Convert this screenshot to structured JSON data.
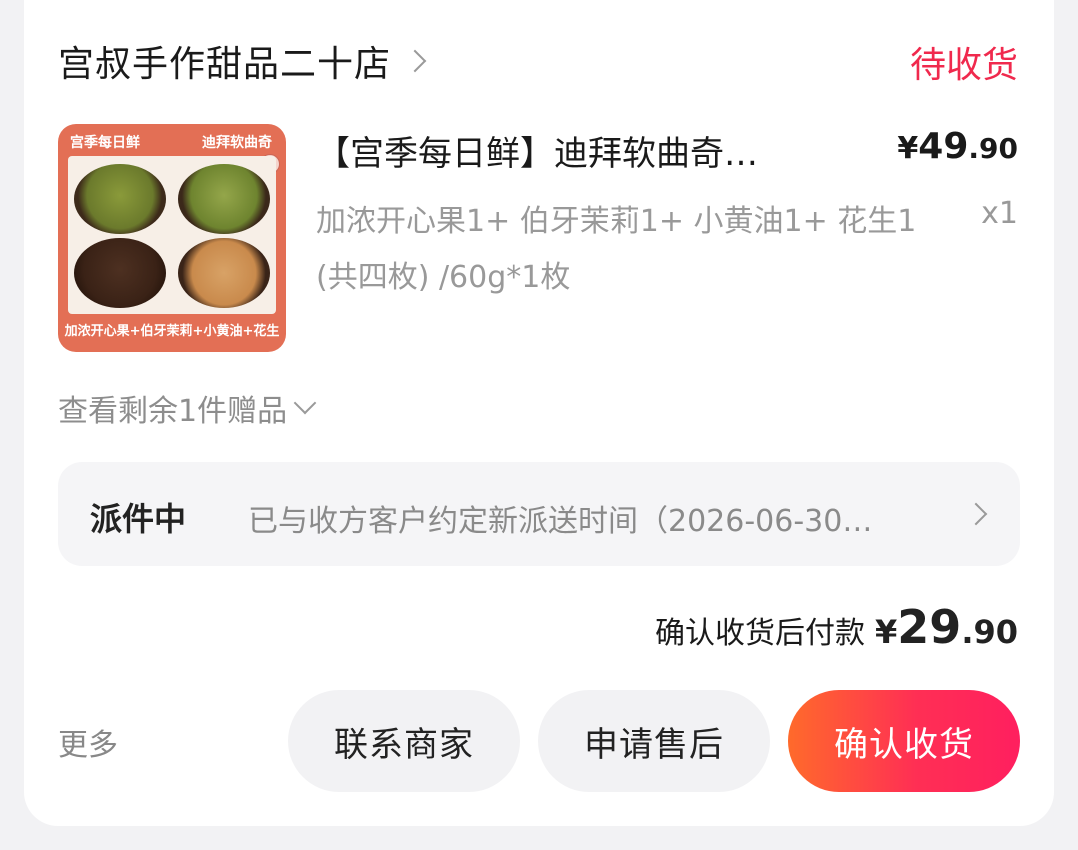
{
  "store": {
    "name": "宫叔手作甜品二十店",
    "status": "待收货"
  },
  "product": {
    "image_labels": {
      "top_left": "宫季每日鲜",
      "top_right": "迪拜软曲奇",
      "bottom": "加浓开心果+伯牙茉莉+小黄油+花生"
    },
    "title": "【宫季每日鲜】迪拜软曲奇…",
    "price": {
      "yen": "¥",
      "int": "49",
      "dec": ".90"
    },
    "spec": "加浓开心果1+ 伯牙茉莉1+ 小黄油1+ 花生1 (共四枚) /60g*1枚",
    "qty": "x1"
  },
  "gifts": {
    "label": "查看剩余1件赠品"
  },
  "logistics": {
    "status": "派件中",
    "text": "已与收方客户约定新派送时间（2026-06-30…"
  },
  "payment": {
    "label": "确认收货后付款",
    "yen": "¥",
    "int": "29",
    "dec": ".90"
  },
  "actions": {
    "more": "更多",
    "contact": "联系商家",
    "after_sale": "申请售后",
    "confirm": "确认收货"
  },
  "colors": {
    "status": "#f0294d",
    "confirm_gradient_start": "#ff6a2b",
    "confirm_gradient_end": "#ff1f5f"
  }
}
